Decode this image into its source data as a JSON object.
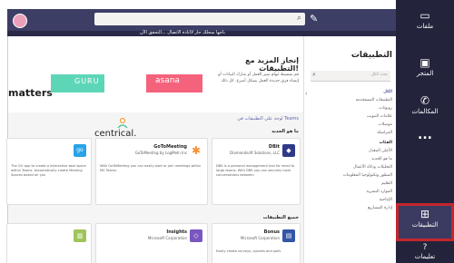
{
  "notice": {
    "text": "باجها سحلك حار لاانادة الاتصال ...التحقق الآن"
  },
  "search": {
    "placeholder": ""
  },
  "hero": {
    "title": "إنجاز المزيد مع التطبيقات!",
    "description": "قم بتبسيط مهام سير العمل أو شارك البيانات أو إنشاء فرق جديدة العمل بشكل أسرع. كل ذلك",
    "link": "لوحة علي التطبيقات في Teams",
    "logos": {
      "guru": "GURU",
      "asana": "asana",
      "matters": "matters",
      "centrical": "centrical."
    }
  },
  "apps_pane": {
    "title": "التطبيقات",
    "search_placeholder": "بحث الكل",
    "categories": [
      {
        "label": "الكل",
        "type": "sel"
      },
      {
        "label": "التطبيقات المستخدمة",
        "type": ""
      },
      {
        "label": "روبوتات",
        "type": ""
      },
      {
        "label": "علامات التبويب",
        "type": ""
      },
      {
        "label": "موصلات",
        "type": ""
      },
      {
        "label": "المراسلة",
        "type": ""
      },
      {
        "label": "الفئات",
        "type": "head"
      },
      {
        "label": "الأعلى المعدل",
        "type": ""
      },
      {
        "label": "ما هو الجديد",
        "type": ""
      },
      {
        "label": "التحليلات وذكاء الأعمال",
        "type": ""
      },
      {
        "label": "المطور وتكنولوجيا المعلومات",
        "type": ""
      },
      {
        "label": "التعليم",
        "type": ""
      },
      {
        "label": "الموارد البشرية",
        "type": ""
      },
      {
        "label": "الإنتاجية",
        "type": ""
      },
      {
        "label": "إدارة المشاريع",
        "type": ""
      }
    ]
  },
  "section_new": {
    "title": "ما هو الجديد"
  },
  "section_all": {
    "title": "جميع التطبيقات"
  },
  "cards_row1": [
    {
      "name": "DBit",
      "publisher": "Diamondsoft Solutions, LLC",
      "desc": "DBit is a personal management tool for small to large teams. With DBit you can securely track conversations between",
      "icon_color": "#2e3a87",
      "icon_glyph": "◆"
    },
    {
      "name": "GoToMeeting",
      "publisher": "GoToMeeting by LogMeIn Inc",
      "desc": "With GoToMeeting you can easily start or join meetings within MS Teams.",
      "icon_color": "#f68d2e",
      "icon_glyph": "✱"
    },
    {
      "name": "",
      "publisher": "",
      "desc": "The GO app to create a interactive task space within Teams. Automatically create Meeting Spaces based on you",
      "icon_color": "#2aa3e6",
      "icon_glyph": "go"
    }
  ],
  "cards_row2": [
    {
      "name": "Bonus",
      "publisher": "Microsoft Corporation",
      "desc": "Easily create surveys, quizzes and polls",
      "icon_color": "#3355a8",
      "icon_glyph": "▤"
    },
    {
      "name": "Insights",
      "publisher": "Microsoft Corporation",
      "desc": "",
      "icon_color": "#7a56c1",
      "icon_glyph": "◇"
    },
    {
      "name": "",
      "publisher": "",
      "desc": "",
      "icon_color": "#9ec55a",
      "icon_glyph": "▥"
    }
  ],
  "rail": {
    "files": "ملفات",
    "store": "المتجر",
    "calls": "المكالمات",
    "more": "...",
    "apps": "التطبيقات",
    "help": "تعليمات"
  }
}
